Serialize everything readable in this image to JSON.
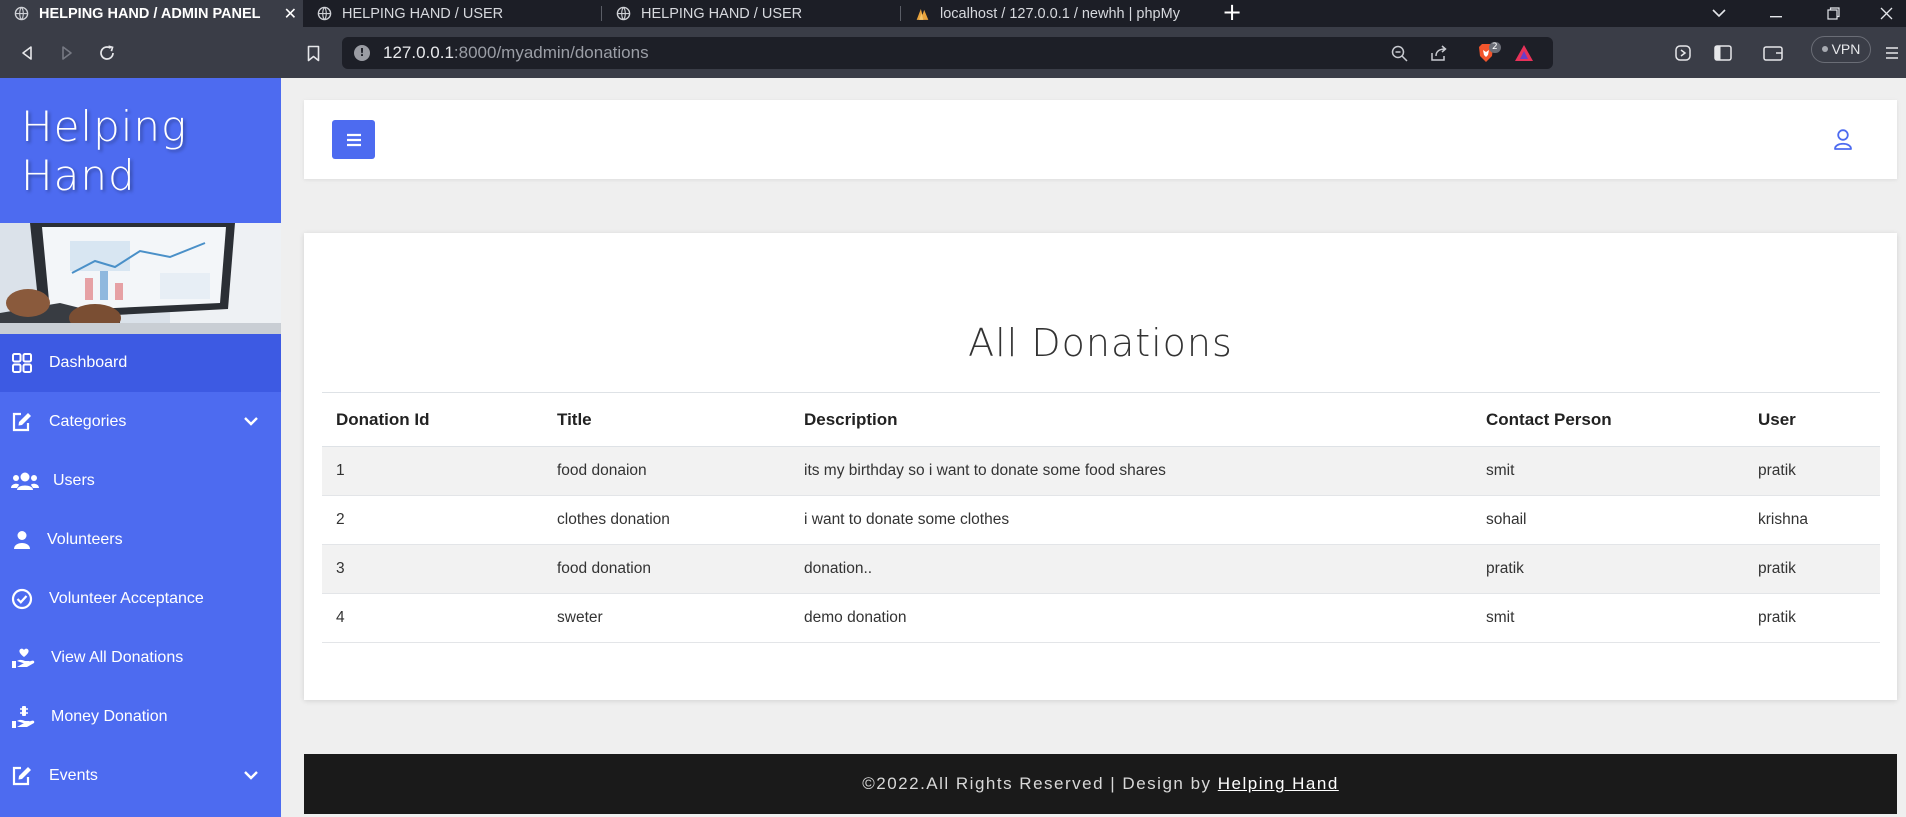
{
  "browser": {
    "tabs": [
      {
        "title": "HELPING HAND / ADMIN PANEL",
        "active": true
      },
      {
        "title": "HELPING HAND / USER",
        "active": false
      },
      {
        "title": "HELPING HAND / USER",
        "active": false
      },
      {
        "title": "localhost / 127.0.0.1 / newhh | phpMy",
        "active": false
      }
    ],
    "close_glyph": "✕",
    "new_tab_glyph": "+",
    "url_host": "127.0.0.1",
    "url_path": ":8000/myadmin/donations",
    "vpn_label": "VPN",
    "shield_badge": "2"
  },
  "sidebar": {
    "brand_line1": "Helping",
    "brand_line2": "Hand",
    "items": [
      {
        "label": "Dashboard",
        "icon": "dashboard-icon",
        "active": true
      },
      {
        "label": "Categories",
        "icon": "edit-icon",
        "dropdown": true
      },
      {
        "label": "Users",
        "icon": "users-icon"
      },
      {
        "label": "Volunteers",
        "icon": "user-icon"
      },
      {
        "label": "Volunteer Acceptance",
        "icon": "check-circle-icon"
      },
      {
        "label": "View All Donations",
        "icon": "hand-holding-icon"
      },
      {
        "label": "Money Donation",
        "icon": "hand-holding-money-icon"
      },
      {
        "label": "Events",
        "icon": "edit-icon",
        "dropdown": true
      }
    ]
  },
  "main": {
    "title": "All Donations",
    "table": {
      "headers": [
        "Donation Id",
        "Title",
        "Description",
        "Contact Person",
        "User"
      ],
      "rows": [
        [
          "1",
          "food donaion",
          "its my birthday so i want to donate some food shares",
          "smit",
          "pratik"
        ],
        [
          "2",
          "clothes donation",
          "i want to donate some clothes",
          "sohail",
          "krishna"
        ],
        [
          "3",
          "food donation",
          "donation..",
          "pratik",
          "pratik"
        ],
        [
          "4",
          "sweter",
          "demo donation",
          "smit",
          "pratik"
        ]
      ]
    }
  },
  "footer": {
    "text": "©2022.All Rights Reserved | Design by",
    "link": "Helping Hand"
  },
  "colors": {
    "sidebar": "#4d6bf0",
    "sidebar_active": "#3d5ae3",
    "accent": "#4d6bf0",
    "footer_bg": "#1a1a1a",
    "tab_bar": "#1c1e26"
  }
}
